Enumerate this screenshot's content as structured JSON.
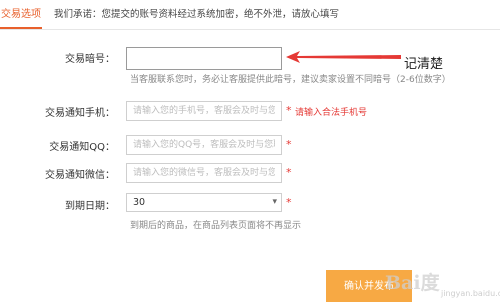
{
  "tab": {
    "label": "交易选项"
  },
  "notice": "我们承诺：您提交的账号资料经过系统加密，绝不外泄，请放心填写",
  "form": {
    "pwd": {
      "label": "交易暗号：",
      "value": "",
      "hint": "当客服联系您时，务必让客服提供此暗号，建议卖家设置不同暗号（2-6位数字）"
    },
    "phone": {
      "label": "交易通知手机：",
      "placeholder": "请输入您的手机号，客服会及时与您联系",
      "star": "*",
      "error": "请输入合法手机号"
    },
    "qq": {
      "label": "交易通知QQ：",
      "placeholder": "请输入您的QQ号，客服会及时与您联系",
      "star": "*"
    },
    "wechat": {
      "label": "交易通知微信：",
      "placeholder": "请输入您的微信号，客服会及时与您联系",
      "star": "*"
    },
    "expire": {
      "label": "到期日期：",
      "value": "30",
      "star": "*",
      "hint": "到期后的商品，在商品列表页面将不再显示"
    }
  },
  "annotation": {
    "text": "记清楚",
    "color": "#e53935"
  },
  "submit_label": "确认并发布",
  "watermark": {
    "text": "Bai度",
    "sub": "jingyan.baidu.com"
  },
  "colors": {
    "accent": "#e8602c",
    "error": "#e53935",
    "button": "#f7a944"
  },
  "icons": {
    "select": "chevron-down-icon",
    "annotation": "arrow-left-icon"
  }
}
